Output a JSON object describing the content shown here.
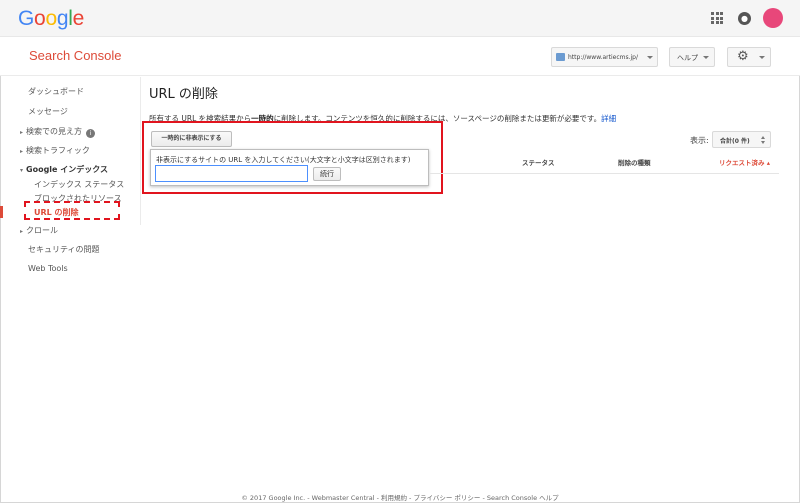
{
  "topbar": {
    "logo_letters": [
      {
        "char": "G",
        "color": "#4285f4"
      },
      {
        "char": "o",
        "color": "#ea4335"
      },
      {
        "char": "o",
        "color": "#fbbc05"
      },
      {
        "char": "g",
        "color": "#4285f4"
      },
      {
        "char": "l",
        "color": "#34a853"
      },
      {
        "char": "e",
        "color": "#ea4335"
      }
    ],
    "icons": [
      "apps-grid-icon",
      "notifications-icon",
      "account-avatar"
    ]
  },
  "header": {
    "app_title": "Search Console",
    "property": "http://www.artiecms.jp/",
    "help_label": "ヘルプ",
    "settings_icon": "gear-icon"
  },
  "sidebar": {
    "items": [
      {
        "label": "ダッシュボード"
      },
      {
        "label": "メッセージ"
      },
      {
        "label": "検索での見え方",
        "arrow": "▸",
        "info": "i"
      },
      {
        "label": "検索トラフィック",
        "arrow": "▸"
      },
      {
        "label": "Google インデックス",
        "arrow": "▾"
      },
      {
        "label": "インデックス ステータス"
      },
      {
        "label": "ブロックされたリソース"
      },
      {
        "label": "URL の削除"
      },
      {
        "label": "クロール",
        "arrow": "▸"
      },
      {
        "label": "セキュリティの問題"
      },
      {
        "label": "Web Tools"
      }
    ]
  },
  "main": {
    "title": "URL の削除",
    "desc_pre": "所有する URL を検索結果から",
    "desc_bold": "一時的",
    "desc_post": "に削除します。コンテンツを恒久的に削除するには、ソースページの削除または更新が必要です。",
    "desc_link": "詳細",
    "hide_button": "一時的に非表示にする",
    "popup_label": "非表示にするサイトの URL を入力してください(大文字と小文字は区別されます)",
    "url_value": "",
    "continue_button": "続行",
    "show_label": "表示:",
    "show_value": "合計(0 件)",
    "columns": {
      "status": "ステータス",
      "removal_type": "削除の種類",
      "requested": "リクエスト済み ▴"
    }
  },
  "footer": {
    "text": "© 2017 Google Inc. - Webmaster Central - 利用規約 - プライバシー ポリシー - Search Console ヘルプ"
  },
  "colors": {
    "accent_red": "#dd4b39",
    "highlight_red": "#e1141e",
    "link_blue": "#1155cc"
  }
}
